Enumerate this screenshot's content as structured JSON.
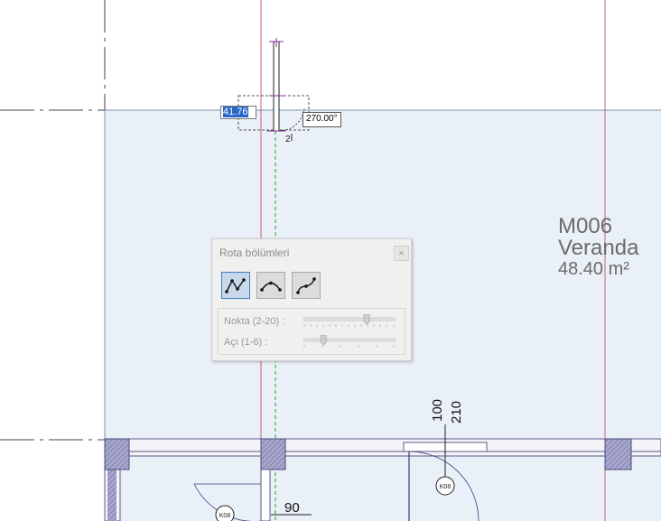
{
  "drawing": {
    "length_input_value": "41.76",
    "angle_readout": "270.00°",
    "vertex_marker": "2",
    "room": {
      "number": "M006",
      "name": "Veranda",
      "area": "48.40 m²"
    },
    "dim_labels": [
      "100",
      "210",
      "90"
    ],
    "door_tags": [
      "K08",
      "K08"
    ]
  },
  "panel": {
    "title": "Rota bölümleri",
    "close_label": "×",
    "mode_buttons": [
      {
        "name": "polyline-mode",
        "active": true
      },
      {
        "name": "arc-mode",
        "active": false
      },
      {
        "name": "spline-mode",
        "active": false
      }
    ],
    "point_label": "Nokta (2-20) :",
    "angle_label": "Açı (1-6) :",
    "point_level": 0.7,
    "angle_level": 0.2
  },
  "colors": {
    "floor_fill": "#e9f0f7",
    "wall_hatch": "#8f8fbf",
    "guide_red": "#c04050",
    "guide_green": "#2aa02a",
    "accent": "#2a66c8"
  }
}
